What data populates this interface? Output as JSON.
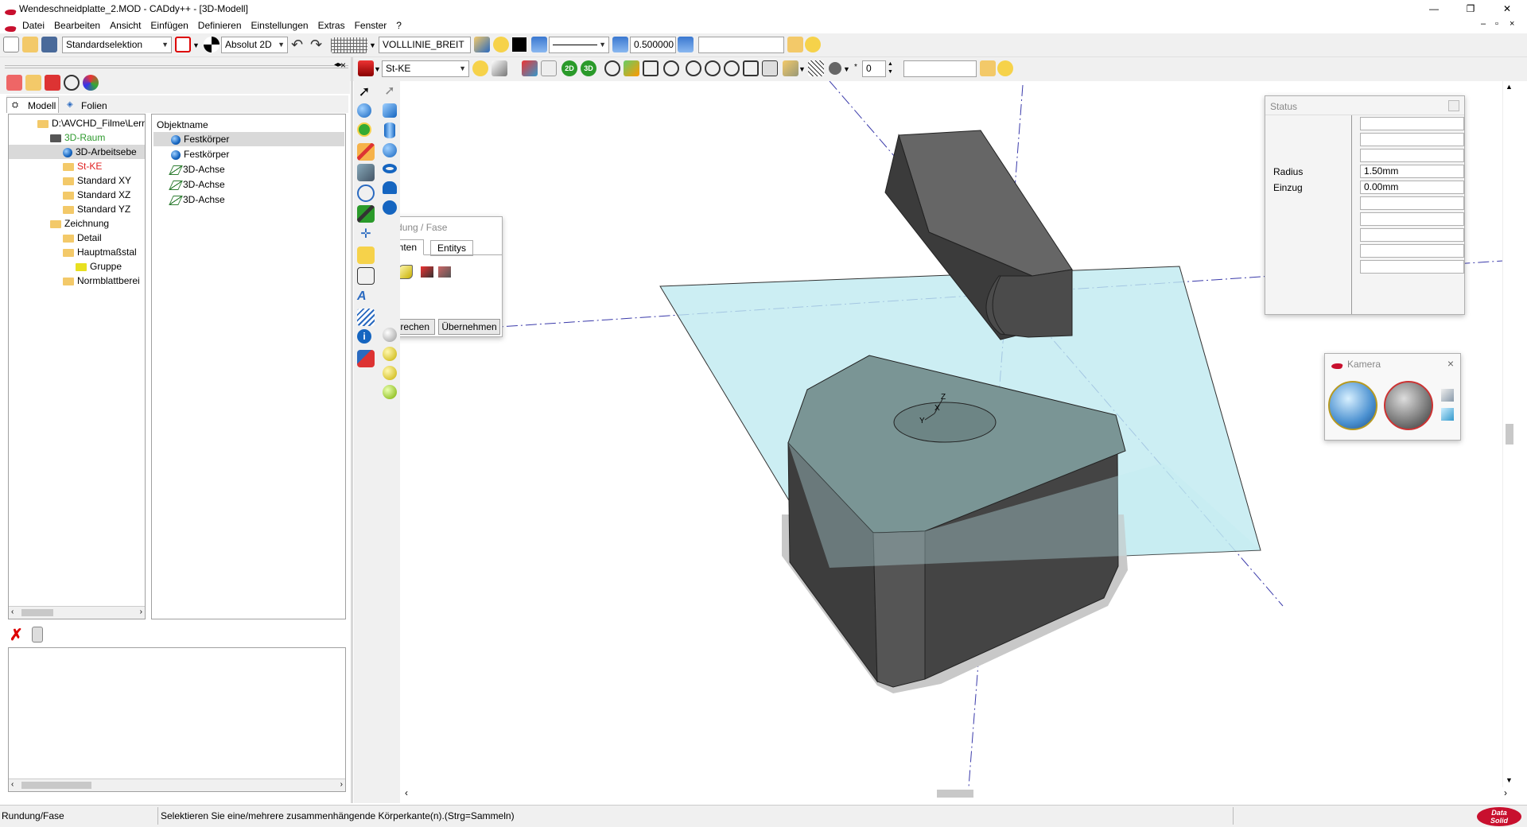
{
  "window": {
    "title": "Wendeschneidplatte_2.MOD  -  CADdy++ - [3D-Modell]",
    "minimize": "—",
    "restore": "❐",
    "close": "✕"
  },
  "menu": [
    "Datei",
    "Bearbeiten",
    "Ansicht",
    "Einfügen",
    "Definieren",
    "Einstellungen",
    "Extras",
    "Fenster",
    "?"
  ],
  "toolbar1": {
    "selection_mode": "Standardselektion",
    "coord_mode": "Absolut 2D",
    "line_style": "VOLLLINIE_BREIT",
    "line_width": "0.500000",
    "text_field": ""
  },
  "toolbar2": {
    "material": "St-KE",
    "angle_value": "0",
    "text_field": ""
  },
  "left_panel": {
    "tabs": [
      "Modell",
      "Folien"
    ],
    "tree": [
      {
        "label": "D:\\AVCHD_Filme\\Lern",
        "type": "folder",
        "indent": 0
      },
      {
        "label": "3D-Raum",
        "type": "space",
        "indent": 1,
        "color": "#2e9a2e"
      },
      {
        "label": "3D-Arbeitsebe",
        "type": "plane",
        "indent": 2,
        "selected": true
      },
      {
        "label": "St-KE",
        "type": "folder",
        "indent": 2,
        "color": "#e02020"
      },
      {
        "label": "Standard XY",
        "type": "folder",
        "indent": 2
      },
      {
        "label": "Standard XZ",
        "type": "folder",
        "indent": 2
      },
      {
        "label": "Standard YZ",
        "type": "folder",
        "indent": 2
      },
      {
        "label": "Zeichnung",
        "type": "folder",
        "indent": 1
      },
      {
        "label": "Detail",
        "type": "folder",
        "indent": 2
      },
      {
        "label": "Hauptmaßstal",
        "type": "folder",
        "indent": 2
      },
      {
        "label": "Gruppe",
        "type": "group",
        "indent": 3
      },
      {
        "label": "Normblattberei",
        "type": "folder",
        "indent": 2
      }
    ],
    "objects_header": "Objektname",
    "objects": [
      {
        "label": "Festkörper",
        "type": "solid",
        "selected": true
      },
      {
        "label": "Festkörper",
        "type": "solid"
      },
      {
        "label": "3D-Achse",
        "type": "axis"
      },
      {
        "label": "3D-Achse",
        "type": "axis"
      },
      {
        "label": "3D-Achse",
        "type": "axis"
      }
    ]
  },
  "rundung_dialog": {
    "title": "Rundung / Fase",
    "tabs": [
      "Kanten",
      "Entitys"
    ],
    "cancel": "Abbrechen",
    "apply": "Übernehmen"
  },
  "status_panel": {
    "title": "Status",
    "rows": [
      {
        "label": "",
        "value": ""
      },
      {
        "label": "",
        "value": ""
      },
      {
        "label": "",
        "value": ""
      },
      {
        "label": "Radius",
        "value": "1.50mm"
      },
      {
        "label": "Einzug",
        "value": "0.00mm"
      },
      {
        "label": "",
        "value": ""
      },
      {
        "label": "",
        "value": ""
      },
      {
        "label": "",
        "value": ""
      },
      {
        "label": "",
        "value": ""
      },
      {
        "label": "",
        "value": ""
      }
    ]
  },
  "camera_panel": {
    "title": "Kamera"
  },
  "axes_labels": {
    "x": "X",
    "y": "Y",
    "z": "Z"
  },
  "statusbar": {
    "mode": "Rundung/Fase",
    "message": "Selektieren Sie eine/mehrere zusammenhängende Körperkante(n).(Strg=Sammeln)",
    "logo_line1": "Data",
    "logo_line2": "Solid"
  },
  "colors": {
    "accent": "#c8102e",
    "plane": "#bfeaf0",
    "solid_dark": "#3d3d3d",
    "solid_top": "#7a9595"
  }
}
